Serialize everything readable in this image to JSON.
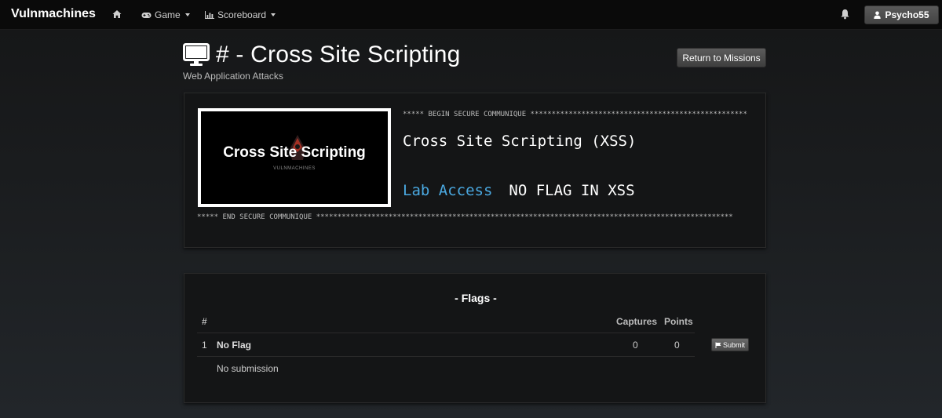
{
  "navbar": {
    "brand": "Vulnmachines",
    "items": [
      {
        "label": "Game",
        "icon": "gamepad-icon"
      },
      {
        "label": "Scoreboard",
        "icon": "chart-icon"
      }
    ],
    "user": "Psycho55"
  },
  "header": {
    "title": "# - Cross Site Scripting",
    "subtitle": "Web Application Attacks",
    "return_label": "Return to Missions"
  },
  "mission": {
    "image_title": "Cross Site Scripting",
    "image_sub": "VULNMACHINES",
    "begin": "***** BEGIN SECURE COMMUNIQUE ***************************************************",
    "name": "Cross Site Scripting (XSS)",
    "lab_link": "Lab Access",
    "note": "NO FLAG IN XSS",
    "end": "***** END SECURE COMMUNIQUE **************************************************************************************************"
  },
  "flags": {
    "title": "- Flags -",
    "columns": [
      "#",
      "Captures",
      "Points"
    ],
    "rows": [
      {
        "num": "1",
        "name": "No Flag",
        "captures": "0",
        "points": "0",
        "action": "Submit",
        "status": "No submission"
      }
    ]
  },
  "colors": {
    "accent_link": "#4aa8e0",
    "background": "#151617",
    "panel": "#141516"
  }
}
